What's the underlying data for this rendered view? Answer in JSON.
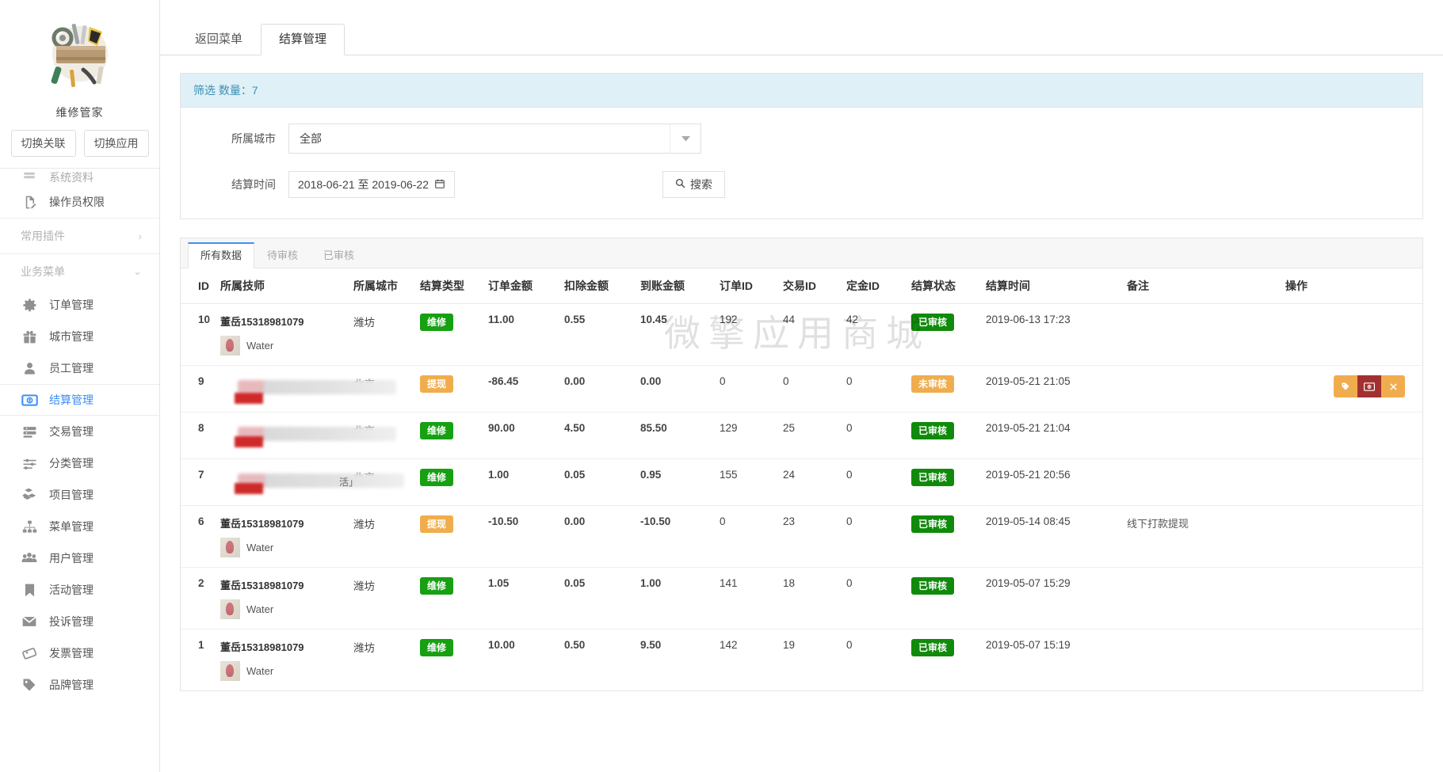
{
  "sidebar": {
    "brand_name": "维修管家",
    "buttons": [
      {
        "label": "切换关联",
        "name": "switch-association-button"
      },
      {
        "label": "切换应用",
        "name": "switch-app-button"
      }
    ],
    "partial_item": {
      "label": "系统资料"
    },
    "items_top": [
      {
        "label": "操作员权限",
        "icon": "document-edit-icon"
      }
    ],
    "group_plugins": {
      "label": "常用插件",
      "chevron": "›"
    },
    "group_business": {
      "label": "业务菜单",
      "chevron": "⌄"
    },
    "items": [
      {
        "label": "订单管理",
        "icon": "gear-icon"
      },
      {
        "label": "城市管理",
        "icon": "gift-icon"
      },
      {
        "label": "员工管理",
        "icon": "user-icon"
      },
      {
        "label": "结算管理",
        "icon": "coin-icon",
        "active": true
      },
      {
        "label": "交易管理",
        "icon": "list-icon"
      },
      {
        "label": "分类管理",
        "icon": "sliders-icon"
      },
      {
        "label": "项目管理",
        "icon": "boxes-icon"
      },
      {
        "label": "菜单管理",
        "icon": "sitemap-icon"
      },
      {
        "label": "用户管理",
        "icon": "users-icon"
      },
      {
        "label": "活动管理",
        "icon": "bookmark-icon"
      },
      {
        "label": "投诉管理",
        "icon": "envelope-icon"
      },
      {
        "label": "发票管理",
        "icon": "ticket-icon"
      },
      {
        "label": "品牌管理",
        "icon": "tag-icon"
      }
    ]
  },
  "topnav": {
    "tabs": [
      {
        "label": "返回菜单",
        "active": false
      },
      {
        "label": "结算管理",
        "active": true
      }
    ]
  },
  "filter": {
    "header_label": "筛选 数量：",
    "header_count": "7",
    "city_label": "所属城市",
    "city_value": "全部",
    "city_placeholder": "全部",
    "time_label": "结算时间",
    "time_value": "2018-06-21 至 2019-06-22",
    "calendar_icon": "calendar-icon",
    "search_button": "搜索",
    "search_icon": "search-icon"
  },
  "table": {
    "tabs": [
      {
        "label": "所有数据",
        "active": true
      },
      {
        "label": "待审核",
        "active": false
      },
      {
        "label": "已审核",
        "active": false
      }
    ],
    "columns": [
      "ID",
      "所属技师",
      "所属城市",
      "结算类型",
      "订单金额",
      "扣除金额",
      "到账金额",
      "订单ID",
      "交易ID",
      "定金ID",
      "结算状态",
      "结算时间",
      "备注",
      "操作"
    ],
    "rows": [
      {
        "id": "10",
        "tech_name": "董岳15318981079",
        "tech_sub": "Water",
        "blurred": false,
        "city": "潍坊",
        "type": "维修",
        "type_color": "green",
        "order_amount": "11.00",
        "deduct_amount": "0.55",
        "received_amount": "10.45",
        "order_id": "192",
        "trade_id": "44",
        "deposit_id": "42",
        "status": "已审核",
        "status_color": "green",
        "settle_time": "2019-06-13 17:23",
        "note": "",
        "ops": false
      },
      {
        "id": "9",
        "tech_name": "",
        "tech_sub": "",
        "blurred": true,
        "blur_tail": "",
        "city": "北京",
        "type": "提现",
        "type_color": "orange",
        "order_amount": "-86.45",
        "deduct_amount": "0.00",
        "received_amount": "0.00",
        "order_id": "0",
        "trade_id": "0",
        "deposit_id": "0",
        "status": "未审核",
        "status_color": "orange",
        "settle_time": "2019-05-21 21:05",
        "note": "",
        "ops": true
      },
      {
        "id": "8",
        "tech_name": "",
        "tech_sub": "",
        "blurred": true,
        "blur_tail": "",
        "city": "北京",
        "type": "维修",
        "type_color": "green",
        "order_amount": "90.00",
        "deduct_amount": "4.50",
        "received_amount": "85.50",
        "order_id": "129",
        "trade_id": "25",
        "deposit_id": "0",
        "status": "已审核",
        "status_color": "green",
        "settle_time": "2019-05-21 21:04",
        "note": "",
        "ops": false
      },
      {
        "id": "7",
        "tech_name": "",
        "tech_sub": "",
        "blurred": true,
        "blur_tail": "活」",
        "city": "北京",
        "type": "维修",
        "type_color": "green",
        "order_amount": "1.00",
        "deduct_amount": "0.05",
        "received_amount": "0.95",
        "order_id": "155",
        "trade_id": "24",
        "deposit_id": "0",
        "status": "已审核",
        "status_color": "green",
        "settle_time": "2019-05-21 20:56",
        "note": "",
        "ops": false
      },
      {
        "id": "6",
        "tech_name": "董岳15318981079",
        "tech_sub": "Water",
        "blurred": false,
        "city": "潍坊",
        "type": "提现",
        "type_color": "orange",
        "order_amount": "-10.50",
        "deduct_amount": "0.00",
        "received_amount": "-10.50",
        "order_id": "0",
        "trade_id": "23",
        "deposit_id": "0",
        "status": "已审核",
        "status_color": "green",
        "settle_time": "2019-05-14 08:45",
        "note": "线下打款提现",
        "ops": false
      },
      {
        "id": "2",
        "tech_name": "董岳15318981079",
        "tech_sub": "Water",
        "blurred": false,
        "city": "潍坊",
        "type": "维修",
        "type_color": "green",
        "order_amount": "1.05",
        "deduct_amount": "0.05",
        "received_amount": "1.00",
        "order_id": "141",
        "trade_id": "18",
        "deposit_id": "0",
        "status": "已审核",
        "status_color": "green",
        "settle_time": "2019-05-07 15:29",
        "note": "",
        "ops": false
      },
      {
        "id": "1",
        "tech_name": "董岳15318981079",
        "tech_sub": "Water",
        "blurred": false,
        "city": "潍坊",
        "type": "维修",
        "type_color": "green",
        "order_amount": "10.00",
        "deduct_amount": "0.50",
        "received_amount": "9.50",
        "order_id": "142",
        "trade_id": "19",
        "deposit_id": "0",
        "status": "已审核",
        "status_color": "green",
        "settle_time": "2019-05-07 15:19",
        "note": "",
        "ops": false
      }
    ],
    "op_icons": {
      "edit": "tag-icon",
      "pay": "money-icon",
      "delete": "close-icon"
    }
  },
  "watermark": "微擎应用商城",
  "colors": {
    "accent": "#3e8ef7",
    "panel_head_bg": "#dff0f7",
    "panel_head_text": "#3b8fb5",
    "green": "#16a012",
    "status_green": "#108a0b",
    "orange": "#f0ad4e",
    "pay_red": "#a33030"
  }
}
